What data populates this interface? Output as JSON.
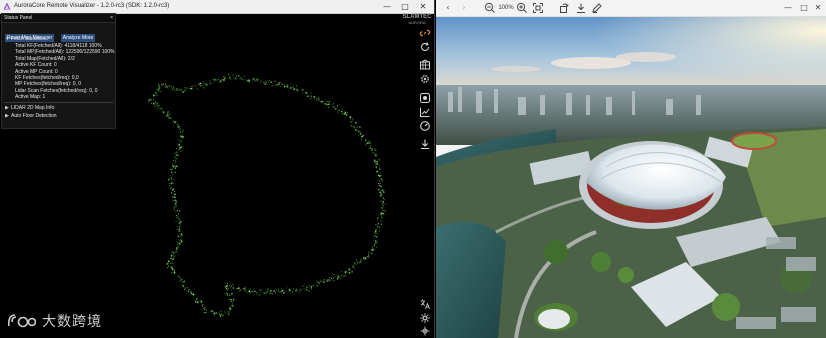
{
  "left_window": {
    "title": "AuroraCore Remote Visualizer - 1.2.0-rc3 (SDK: 1.2.0-rc3)",
    "controls": {
      "minimize": "—",
      "maximize": "□",
      "close": "✕"
    }
  },
  "status_panel": {
    "title": "Status Panel",
    "close": "×",
    "buttons": {
      "reset": "Reset Map Manager",
      "analyze": "Analyze More"
    },
    "fetch_section": "Fetch Statistics",
    "stats": [
      "Total KF(Fetched/All): 4118/4118 100%",
      "Total MP(Fetched/All): 122590/122590 100%",
      "Total Map(Fetched/All): 2/2",
      "Active KF Count: 0",
      "Active MP Count: 0",
      "KF Fetches(fetched/req): 0,0",
      "MP Fetches(fetched/req): 0, 0",
      "Lidar Scan Fetches(fetched/req): 0, 0",
      "Active Map: 1"
    ],
    "lidar_section": "LIDAR 2D Map Info",
    "floor_section": "Auto Floor Detection"
  },
  "brand": {
    "line1": "SLAMTEC",
    "line2": "AURORA"
  },
  "toolbar_icons": [
    "link-icon",
    "refresh-icon",
    "map-icon",
    "settings-icon",
    "record-icon",
    "chart-icon",
    "gauge-icon",
    "download-icon",
    "translate-icon",
    "sparkle-icon",
    "crosshair-icon"
  ],
  "watermark": {
    "text": "大数跨境"
  },
  "viewer": {
    "zoom": "100%",
    "controls": {
      "minimize": "—",
      "maximize": "□",
      "close": "✕"
    }
  },
  "colors": {
    "map_points": "#7ee061",
    "map_points_dark": "#3f8a2a",
    "button_blue": "#2c4e7c"
  }
}
